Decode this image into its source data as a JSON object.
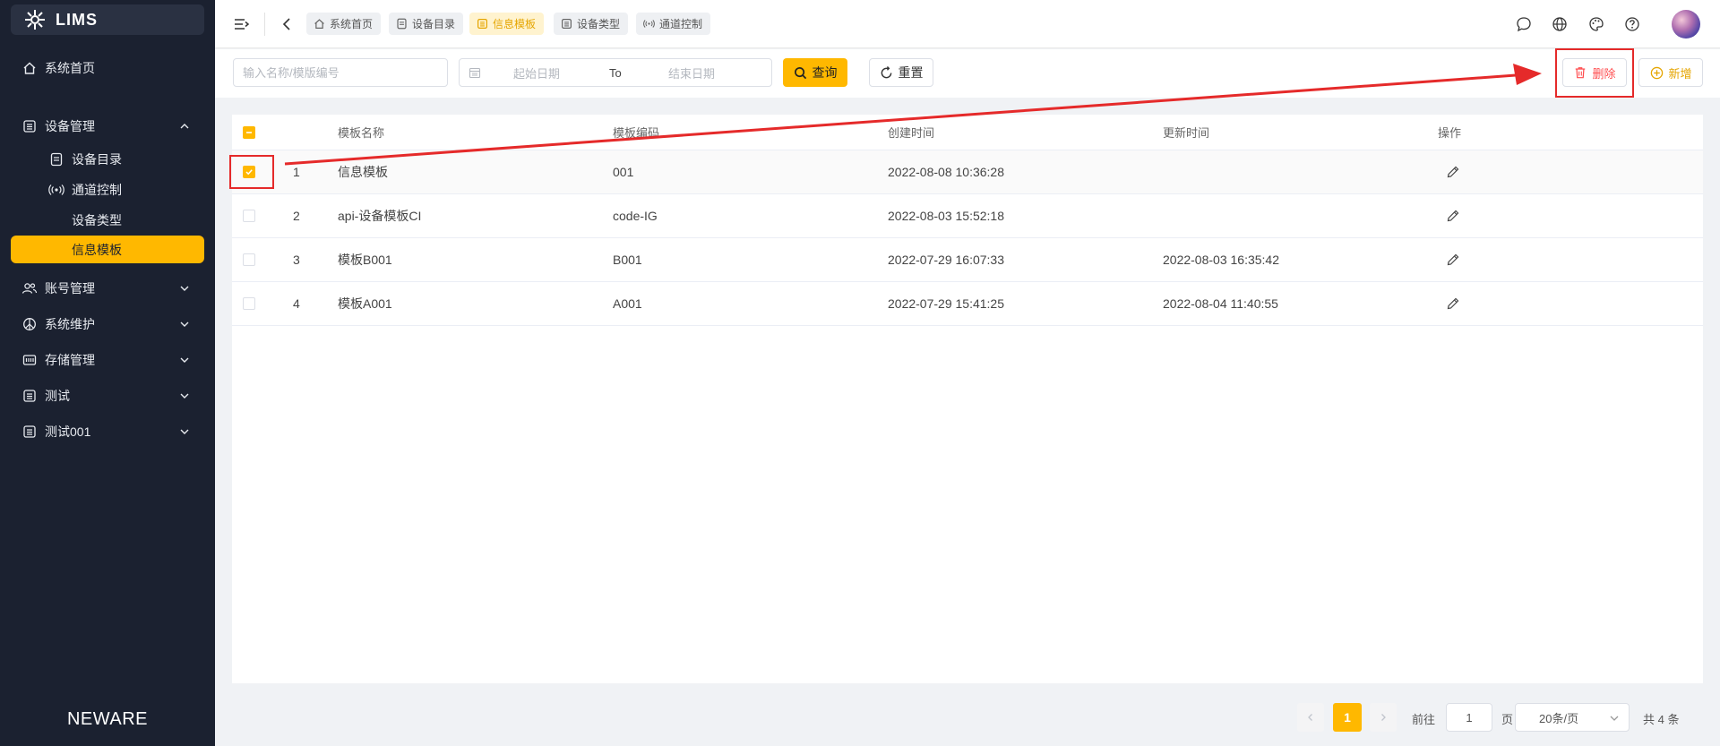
{
  "app": {
    "logo_text": "LIMS",
    "brand_footer": "NEWARE"
  },
  "sidebar": {
    "items": [
      {
        "label": "系统首页",
        "icon": "home-icon"
      },
      {
        "label": "设备管理",
        "icon": "list-icon",
        "expanded": true,
        "children": [
          {
            "label": "设备目录",
            "icon": "document-icon"
          },
          {
            "label": "通道控制",
            "icon": "broadcast-icon"
          },
          {
            "label": "设备类型",
            "icon": ""
          },
          {
            "label": "信息模板",
            "icon": "",
            "active": true
          }
        ]
      },
      {
        "label": "账号管理",
        "icon": "users-icon"
      },
      {
        "label": "系统维护",
        "icon": "peace-icon"
      },
      {
        "label": "存储管理",
        "icon": "storage-icon"
      },
      {
        "label": "测试",
        "icon": "list-icon"
      },
      {
        "label": "测试001",
        "icon": "list-icon"
      }
    ]
  },
  "header": {
    "tabs": [
      {
        "label": "系统首页",
        "icon": "home-icon"
      },
      {
        "label": "设备目录",
        "icon": "document-icon"
      },
      {
        "label": "信息模板",
        "icon": "list-icon",
        "active": true
      },
      {
        "label": "设备类型",
        "icon": "list-icon"
      },
      {
        "label": "通道控制",
        "icon": "broadcast-icon"
      }
    ]
  },
  "toolbar": {
    "search_placeholder": "输入名称/模版编号",
    "start_date_placeholder": "起始日期",
    "date_separator": "To",
    "end_date_placeholder": "结束日期",
    "query_label": "查询",
    "reset_label": "重置",
    "delete_label": "删除",
    "add_label": "新增"
  },
  "table": {
    "columns": [
      "模板名称",
      "模板编码",
      "创建时间",
      "更新时间",
      "操作"
    ],
    "rows": [
      {
        "index": "1",
        "name": "信息模板",
        "code": "001",
        "created": "2022-08-08 10:36:28",
        "updated": "",
        "checked": true
      },
      {
        "index": "2",
        "name": "api-设备模板CI",
        "code": "code-IG",
        "created": "2022-08-03 15:52:18",
        "updated": "",
        "checked": false
      },
      {
        "index": "3",
        "name": "模板B001",
        "code": "B001",
        "created": "2022-07-29 16:07:33",
        "updated": "2022-08-03 16:35:42",
        "checked": false
      },
      {
        "index": "4",
        "name": "模板A001",
        "code": "A001",
        "created": "2022-07-29 15:41:25",
        "updated": "2022-08-04 11:40:55",
        "checked": false
      }
    ]
  },
  "pagination": {
    "current_page": "1",
    "goto_label": "前往",
    "goto_value": "1",
    "page_suffix": "页",
    "page_size": "20条/页",
    "total": "共 4 条"
  },
  "colors": {
    "accent": "#ffb800",
    "sidebar_bg": "#1b2130",
    "danger": "#ff4d4f",
    "annotation": "#e52a2a"
  }
}
